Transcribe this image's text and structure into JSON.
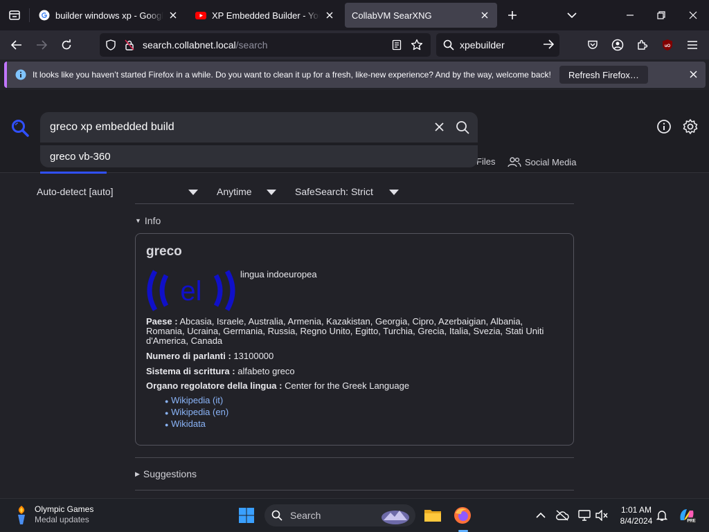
{
  "browser": {
    "tabs": [
      {
        "title": "builder windows xp - Google Se",
        "icon": "google-icon",
        "active": false
      },
      {
        "title": "XP Embedded Builder - YouTub",
        "icon": "youtube-icon",
        "active": false
      },
      {
        "title": "CollabVM SearXNG",
        "icon": "",
        "active": true
      }
    ],
    "url_host": "search.collabnet.local",
    "url_path": "/search",
    "search_value": "xpebuilder",
    "notification_text": "It looks like you haven’t started Firefox in a while. Do you want to clean it up for a fresh, like-new experience? And by the way, welcome back!",
    "notification_button": "Refresh Firefox…",
    "colors": {
      "accent": "#c276ff",
      "chrome_bg": "#1c1b22",
      "toolbar_bg": "#2b2a33"
    }
  },
  "search": {
    "query": "greco xp embedded build",
    "suggestion": "greco vb-360",
    "categories": [
      {
        "label": "Files",
        "icon": "files-icon"
      },
      {
        "label": "Social Media",
        "icon": "people-icon"
      }
    ],
    "filters": {
      "language": "Auto-detect [auto]",
      "time": "Anytime",
      "safesearch": "SafeSearch: Strict"
    }
  },
  "infobox": {
    "section_label": "Info",
    "title": "greco",
    "logo_text": "el",
    "description": "lingua indoeuropea",
    "facts": [
      {
        "key": "Paese :",
        "value": "Abcasia, Israele, Australia, Armenia, Kazakistan, Georgia, Cipro, Azerbaigian, Albania, Romania, Ucraina, Germania, Russia, Regno Unito, Egitto, Turchia, Grecia, Italia, Svezia, Stati Uniti d'America, Canada"
      },
      {
        "key": "Numero di parlanti :",
        "value": "13100000"
      },
      {
        "key": "Sistema di scrittura :",
        "value": "alfabeto greco"
      },
      {
        "key": "Organo regolatore della lingua :",
        "value": "Center for the Greek Language"
      }
    ],
    "links": [
      "Wikipedia (it)",
      "Wikipedia (en)",
      "Wikidata"
    ]
  },
  "suggestions_label": "Suggestions",
  "taskbar": {
    "widget_title": "Olympic Games",
    "widget_subtitle": "Medal updates",
    "search_placeholder": "Search",
    "time": "1:01 AM",
    "date": "8/4/2024"
  }
}
